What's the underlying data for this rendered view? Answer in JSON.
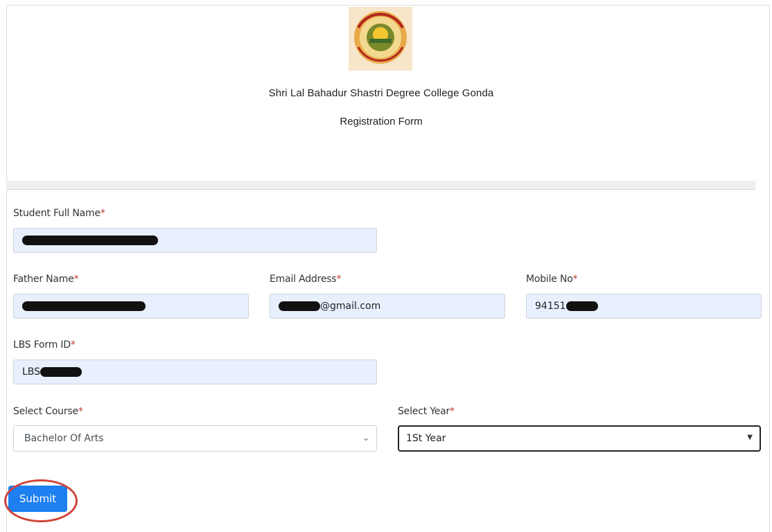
{
  "header": {
    "college_name": "Shri Lal Bahadur Shastri Degree College Gonda",
    "form_title": "Registration Form",
    "logo_text": "गोण्डा"
  },
  "fields": {
    "student_full_name": {
      "label": "Student Full Name",
      "required_mark": "*"
    },
    "father_name": {
      "label": "Father Name",
      "required_mark": "*"
    },
    "email": {
      "label": "Email Address",
      "required_mark": "*",
      "value_suffix": "@gmail.com"
    },
    "mobile": {
      "label": "Mobile No",
      "required_mark": "*",
      "value_prefix": "94151"
    },
    "lbs_form_id": {
      "label": "LBS Form ID",
      "required_mark": "*",
      "value_prefix": "LBS"
    },
    "course": {
      "label": "Select Course",
      "required_mark": "*",
      "selected": "Bachelor Of Arts"
    },
    "year": {
      "label": "Select Year",
      "required_mark": "*",
      "selected": "1St Year"
    }
  },
  "actions": {
    "submit_label": "Submit"
  },
  "colors": {
    "input_bg": "#e8f0fe",
    "button": "#1d7ff0",
    "required": "#c0392b",
    "annotation_circle": "#d0453a"
  },
  "icons": {
    "course_dropdown": "chevron-down-icon",
    "year_dropdown": "caret-down-icon"
  }
}
